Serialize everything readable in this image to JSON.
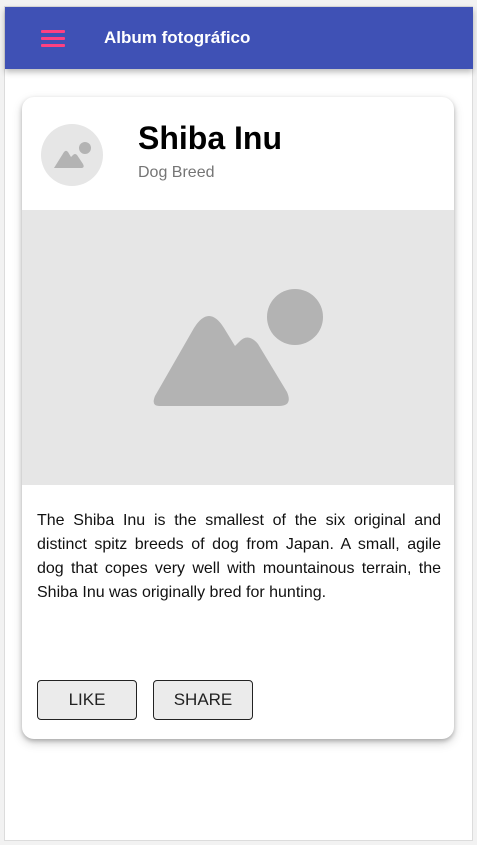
{
  "toolbar": {
    "menu_icon": "menu-icon",
    "title": "Album fotográfico"
  },
  "card": {
    "avatar_icon": "image-placeholder-icon",
    "title": "Shiba Inu",
    "subtitle": "Dog Breed",
    "media_icon": "image-placeholder-icon",
    "content": "The Shiba Inu is the smallest of the six original and distinct spitz breeds of dog from Japan. A small, agile dog that copes very well with mountainous terrain, the Shiba Inu was originally bred for hunting.",
    "actions": {
      "like_label": "LIKE",
      "share_label": "SHARE"
    }
  },
  "colors": {
    "toolbar": "#3f51b5",
    "accent": "#ff4081",
    "placeholder_bg": "#e6e6e6",
    "placeholder_shape": "#b3b3b3"
  }
}
